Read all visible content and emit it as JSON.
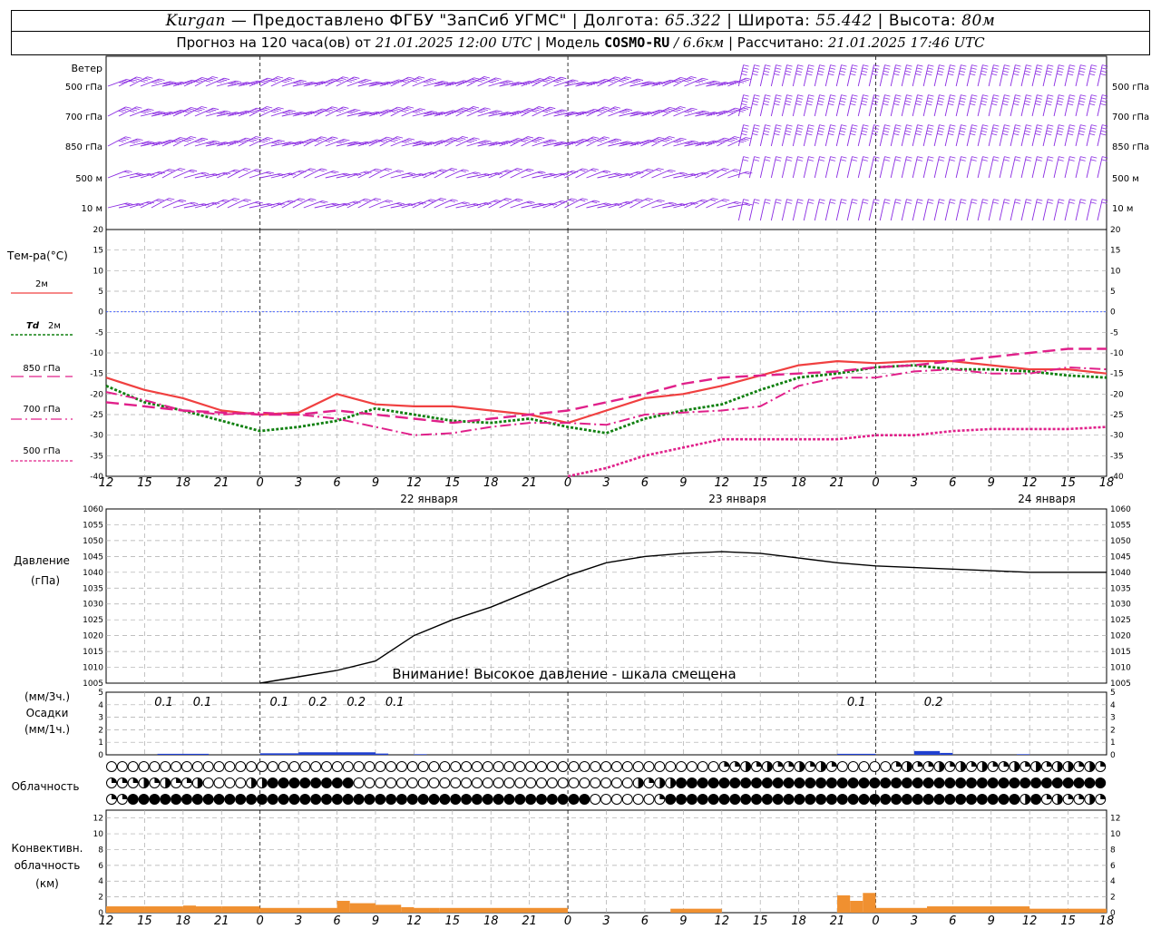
{
  "header": {
    "station": "Kurgan",
    "provider": "— Предоставлено ФГБУ \"ЗапСиб УГМС\"",
    "lon_label": "Долгота:",
    "lon": "65.322",
    "lat_label": "Широта:",
    "lat": "55.442",
    "alt_label": "Высота:",
    "alt": "80м",
    "forecast_label": "Прогноз на 120 часа(ов) от",
    "forecast_start": "21.01.2025 12:00 UTC",
    "model_label": "Модель",
    "model": "COSMO-RU",
    "resolution": "/ 6.6км",
    "computed_label": "Рассчитано:",
    "computed": "21.01.2025 17:46 UTC"
  },
  "labels": {
    "wind": "Ветер",
    "wind_levels": [
      "500 гПа",
      "700 гПа",
      "850 гПа",
      "500 м",
      "10 м"
    ],
    "temp": "Тем-ра(°C)",
    "t2m": "2м",
    "td": "Td",
    "td2m": "2м",
    "t850": "850 гПа",
    "t700": "700 гПа",
    "t500": "500 гПа",
    "pressure": "Давление",
    "pressure_unit": "(гПа)",
    "pressure_warning": "Внимание! Высокое давление - шкала смещена",
    "precip_unit3": "(мм/3ч.)",
    "precip": "Осадки",
    "precip_unit1": "(мм/1ч.)",
    "cloud": "Облачность",
    "conv1": "Конвективн.",
    "conv2": "облачность",
    "conv3": "(км)",
    "days": [
      "22 января",
      "23 января",
      "24 января"
    ]
  },
  "colors": {
    "t2m": "#f04040",
    "td": "#108010",
    "t850": "#e0208a",
    "t700": "#e0208a",
    "t500": "#e0208a",
    "wind": "#8a2be2",
    "precip": "#2040d0",
    "conv": "#f09030",
    "zero_line": "#3050ff"
  },
  "chart_data": {
    "x_hours": [
      0,
      3,
      6,
      9,
      12,
      15,
      18,
      21,
      24,
      27,
      30,
      33,
      36,
      39,
      42,
      45,
      48,
      51,
      54,
      57,
      60,
      63,
      66,
      69,
      72,
      75,
      78
    ],
    "x_tick_labels": [
      "12",
      "15",
      "18",
      "21",
      "0",
      "3",
      "6",
      "9",
      "12",
      "15",
      "18",
      "21",
      "0",
      "3",
      "6",
      "9",
      "12",
      "15",
      "18",
      "21",
      "0",
      "3",
      "6",
      "9",
      "12",
      "15",
      "18"
    ],
    "temperature": {
      "type": "line",
      "ylim": [
        -40,
        20
      ],
      "ticks": [
        20,
        15,
        10,
        5,
        0,
        -5,
        -10,
        -15,
        -20,
        -25,
        -30,
        -35,
        -40
      ],
      "series": [
        {
          "name": "2м",
          "values": [
            -16,
            -19,
            -21,
            -24,
            -25,
            -24.5,
            -20,
            -22.5,
            -23,
            -23,
            -24,
            -25,
            -27,
            -24,
            -21,
            -20,
            -18,
            -15.5,
            -13,
            -12,
            -12.5,
            -12,
            -12,
            -13,
            -14,
            -14,
            -15
          ]
        },
        {
          "name": "Td 2м",
          "values": [
            -18,
            -22,
            -24,
            -26.5,
            -29,
            -28,
            -26.5,
            -23.5,
            -25,
            -26.5,
            -27,
            -26,
            -28,
            -29.5,
            -26,
            -24,
            -22.5,
            -19,
            -16,
            -15,
            -13.5,
            -13,
            -14,
            -14,
            -14.5,
            -15.5,
            -16
          ]
        },
        {
          "name": "850 гПа",
          "values": [
            -22,
            -23,
            -24,
            -24.5,
            -25,
            -25,
            -24,
            -25,
            -26,
            -27,
            -26,
            -25,
            -24,
            -22,
            -20,
            -17.5,
            -16,
            -15.5,
            -15,
            -14.5,
            -13.5,
            -13,
            -12,
            -11,
            -10,
            -9,
            -9
          ]
        },
        {
          "name": "700 гПа",
          "values": [
            -19.5,
            -21.5,
            -24,
            -25,
            -24.5,
            -25,
            -26,
            -28,
            -30,
            -29.5,
            -28,
            -27,
            -27,
            -27.5,
            -25,
            -24.5,
            -24,
            -23,
            -18,
            -16,
            -16,
            -14.5,
            -14,
            -15,
            -15,
            -13.5,
            -14
          ]
        },
        {
          "name": "500 гПа",
          "values": [
            null,
            null,
            null,
            null,
            null,
            null,
            null,
            null,
            null,
            -40,
            -40.5,
            -41,
            -40,
            -38,
            -35,
            -33,
            -31,
            -31,
            -31,
            -31,
            -30,
            -30,
            -29,
            -28.5,
            -28.5,
            -28.5,
            -28
          ]
        }
      ]
    },
    "pressure": {
      "type": "line",
      "ylim": [
        1005,
        1060
      ],
      "ticks": [
        1060,
        1055,
        1050,
        1045,
        1040,
        1035,
        1030,
        1025,
        1020,
        1015,
        1010,
        1005
      ],
      "values": [
        null,
        null,
        null,
        null,
        1005,
        1007,
        1009,
        1012,
        1020,
        1025,
        1029,
        1034,
        1039,
        1043,
        1045,
        1046,
        1046.5,
        1046,
        1044.5,
        1043,
        1042,
        1041.5,
        1041,
        1040.5,
        1040,
        1040,
        1040
      ]
    },
    "precipitation": {
      "type": "bar",
      "ylim": [
        0,
        5
      ],
      "ticks": [
        5,
        4,
        3,
        2,
        1,
        0
      ],
      "labels": [
        {
          "hour": 4.5,
          "text": "0.1"
        },
        {
          "hour": 7.5,
          "text": "0.1"
        },
        {
          "hour": 13.5,
          "text": "0.1"
        },
        {
          "hour": 16.5,
          "text": "0.2"
        },
        {
          "hour": 19.5,
          "text": "0.2"
        },
        {
          "hour": 22.5,
          "text": "0.1"
        }
      ],
      "labels2": [
        {
          "hour": 58.5,
          "text": "0.1"
        },
        {
          "hour": 64.5,
          "text": "0.2"
        }
      ],
      "bars": [
        [
          4,
          8,
          0.08
        ],
        [
          12,
          15,
          0.12
        ],
        [
          15,
          21,
          0.2
        ],
        [
          21,
          22,
          0.1
        ],
        [
          24,
          25,
          0.05
        ],
        [
          57,
          60,
          0.08
        ],
        [
          63,
          65,
          0.3
        ],
        [
          65,
          66,
          0.15
        ],
        [
          71,
          72,
          0.05
        ]
      ]
    },
    "convective": {
      "type": "bar",
      "ylim": [
        0,
        13
      ],
      "ticks": [
        12,
        10,
        8,
        6,
        4,
        2,
        0
      ],
      "bars": [
        [
          0,
          3,
          0.8
        ],
        [
          3,
          6,
          0.8
        ],
        [
          6,
          7,
          0.9
        ],
        [
          7,
          9,
          0.8
        ],
        [
          9,
          12,
          0.8
        ],
        [
          12,
          15,
          0.6
        ],
        [
          15,
          18,
          0.6
        ],
        [
          18,
          19,
          1.5
        ],
        [
          19,
          21,
          1.2
        ],
        [
          21,
          23,
          1.0
        ],
        [
          23,
          24,
          0.7
        ],
        [
          24,
          26,
          0.6
        ],
        [
          26,
          30,
          0.6
        ],
        [
          30,
          36,
          0.6
        ],
        [
          44,
          48,
          0.5
        ],
        [
          57,
          58,
          2.2
        ],
        [
          58,
          59,
          1.5
        ],
        [
          59,
          60,
          2.5
        ],
        [
          60,
          64,
          0.6
        ],
        [
          64,
          72,
          0.8
        ],
        [
          72,
          78,
          0.5
        ]
      ]
    },
    "cloud_rows": [
      "OOOOOOOOOOOOOOOOOOOOOOOOOOOOOOOOOOOOOOOOOOOOOOOOOOOOOOOOOOOOOOOOOOOOOOOOOOOOOOOOOOOOOOOOOOOOOOOOTTTTHHTTHHTTHHTTHHTTOOOOOOOOTTHHTTHHTTHHTTHHTTHHTTHHTTHTHTHHTTH",
      "TTTTHHTTHHTTHHOOOOOOOOHHFFFFFFFFFFFFFFOOOOOOOOOOOOOOOOOOOOOOOOOOOOOOOOOOOOOOOOOOOOOHHTTHHFFFFFFFFFFFFFFFFFFFFFFFFFFFFFFFFFFFFFFFFFFFFFFFFFFFFFFFFFFFFFFFFFFFFFF",
      "TTFFFFFFFFFFFFFFFFFFFFFFFFFFFFFFFFFFFFFFFFFFFFFFFFFFFFFFFFFFFFFFFFFFFFFFFFFFOOOOOOOOOOTTFFFFFFFFFFFFFFFFFFFFFFFFFFFFFFFFFFFFFFFFFFFFFFFFFFFFFFFFHHFFTTHHTTHHHTT"
    ]
  }
}
